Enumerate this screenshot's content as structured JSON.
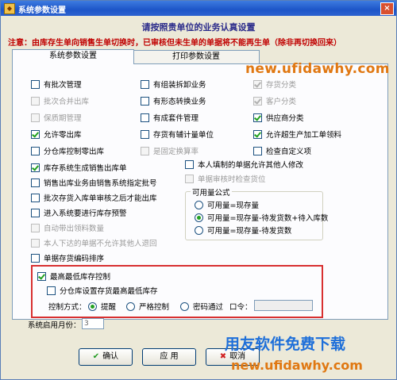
{
  "window": {
    "title": "系统参数设置"
  },
  "heading": "请按照贵单位的业务认真设置",
  "notice": "注意：由库存生单向销售生单切换时，已审核但未生单的单据将不能再生单（除非再切换回来）",
  "tabs": [
    "系统参数设置",
    "打印参数设置"
  ],
  "checkboxes": [
    {
      "label": "有批次管理",
      "checked": false,
      "disabled": false
    },
    {
      "label": "有组装拆卸业务",
      "checked": false,
      "disabled": false
    },
    {
      "label": "存货分类",
      "checked": true,
      "disabled": true
    },
    {
      "label": "批次合并出库",
      "checked": false,
      "disabled": true
    },
    {
      "label": "有形态转换业务",
      "checked": false,
      "disabled": false
    },
    {
      "label": "客户分类",
      "checked": true,
      "disabled": true
    },
    {
      "label": "保质期管理",
      "checked": false,
      "disabled": true
    },
    {
      "label": "有成套件管理",
      "checked": false,
      "disabled": false
    },
    {
      "label": "供应商分类",
      "checked": true,
      "disabled": false
    },
    {
      "label": "允许零出库",
      "checked": true,
      "disabled": false
    },
    {
      "label": "存货有辅计量单位",
      "checked": false,
      "disabled": false
    },
    {
      "label": "允许超生产加工单领料",
      "checked": true,
      "disabled": false
    },
    {
      "label": "分仓库控制零出库",
      "checked": false,
      "disabled": false
    },
    {
      "label": "是固定换算率",
      "checked": false,
      "disabled": true
    },
    {
      "label": "检查自定义项",
      "checked": false,
      "disabled": false
    },
    {
      "label": "库存系统生成销售出库单",
      "checked": true,
      "disabled": false
    },
    {
      "label": "本人填制的单据允许其他人修改",
      "checked": false,
      "disabled": false
    },
    {
      "label": "销售出库业务由销售系统指定批号",
      "checked": false,
      "disabled": false
    },
    {
      "label": "单据审核时检查货位",
      "checked": false,
      "disabled": true
    },
    {
      "label": "批次存货入库单审核之后才能出库",
      "checked": false,
      "disabled": false
    },
    {
      "label": "进入系统要进行库存预警",
      "checked": false,
      "disabled": false
    },
    {
      "label": "自动带出领料数量",
      "checked": false,
      "disabled": true
    },
    {
      "label": "本人下达的单据不允许其他人退回",
      "checked": false,
      "disabled": true
    },
    {
      "label": "单据存货编码排序",
      "checked": false,
      "disabled": false
    }
  ],
  "available_qty": {
    "title": "可用量公式",
    "options": [
      "可用量=现存量",
      "可用量=现存量-待发货数+待入库数",
      "可用量=现存量-待发货数"
    ],
    "selected": 1
  },
  "min_stock": {
    "main_label": "最高最低库存控制",
    "main_checked": true,
    "sub_label": "分仓库设置存货最高最低库存",
    "sub_checked": false,
    "mode_label": "控制方式：",
    "modes": [
      "提醒",
      "严格控制",
      "密码通过"
    ],
    "mode_selected": 0,
    "password_label": "口令："
  },
  "year": {
    "label": "系统启用月份：",
    "value": "3"
  },
  "buttons": {
    "ok": "确认",
    "apply": "应 用",
    "cancel": "取消"
  },
  "icons": {
    "ok": "check-icon",
    "cancel": "cross-icon",
    "close": "close-icon",
    "app": "app-icon"
  },
  "watermarks": {
    "top_url": "new.ufidawhy.com",
    "bottom_text": "用友软件免费下载",
    "bottom_url": "new.ufidawhy.com"
  },
  "colors": {
    "notice": "#c00000",
    "heading": "#2a2a8a",
    "watermark_orange": "#e07812",
    "watermark_blue": "#1e6fd9",
    "check": "#21a121"
  }
}
